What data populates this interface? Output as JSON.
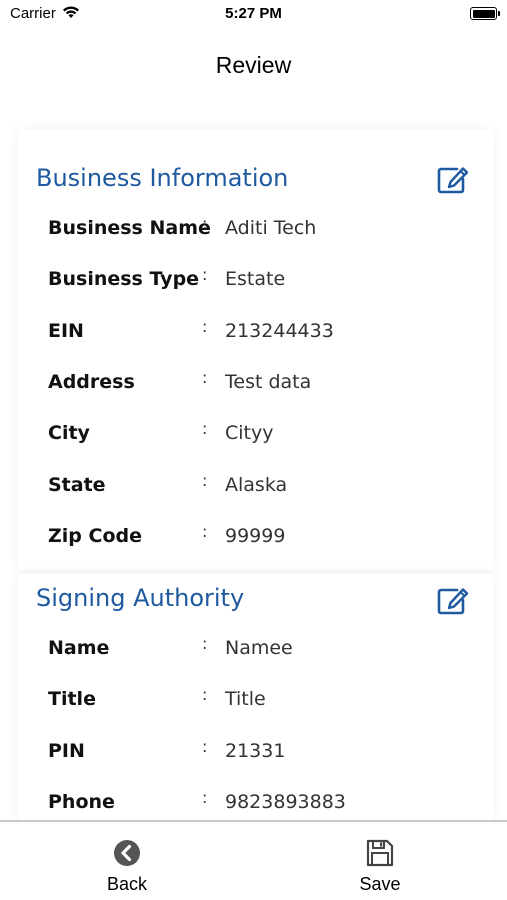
{
  "status_bar": {
    "carrier": "Carrier",
    "time": "5:27 PM"
  },
  "nav": {
    "title": "Review"
  },
  "business": {
    "title": "Business Information",
    "rows": [
      {
        "label": "Business Name",
        "colon": ":",
        "value": "Aditi Tech"
      },
      {
        "label": "Business Type",
        "colon": ":",
        "value": "Estate"
      },
      {
        "label": "EIN",
        "colon": ":",
        "value": "213244433"
      },
      {
        "label": "Address",
        "colon": ":",
        "value": "Test data"
      },
      {
        "label": "City",
        "colon": ":",
        "value": "Cityy"
      },
      {
        "label": "State",
        "colon": ":",
        "value": "Alaska"
      },
      {
        "label": "Zip Code",
        "colon": ":",
        "value": "99999"
      }
    ]
  },
  "signing": {
    "title": "Signing Authority",
    "rows": [
      {
        "label": "Name",
        "colon": ":",
        "value": "Namee"
      },
      {
        "label": "Title",
        "colon": ":",
        "value": "Title"
      },
      {
        "label": "PIN",
        "colon": ":",
        "value": "21331"
      },
      {
        "label": "Phone",
        "colon": ":",
        "value": "9823893883"
      }
    ]
  },
  "bottom_bar": {
    "back_label": "Back",
    "save_label": "Save"
  },
  "colors": {
    "accent": "#1f5aa0",
    "icon_gray": "#555555"
  },
  "icons": {
    "edit": "edit-icon",
    "back": "back-icon",
    "save": "save-icon",
    "wifi": "wifi-icon",
    "battery": "battery-icon"
  }
}
